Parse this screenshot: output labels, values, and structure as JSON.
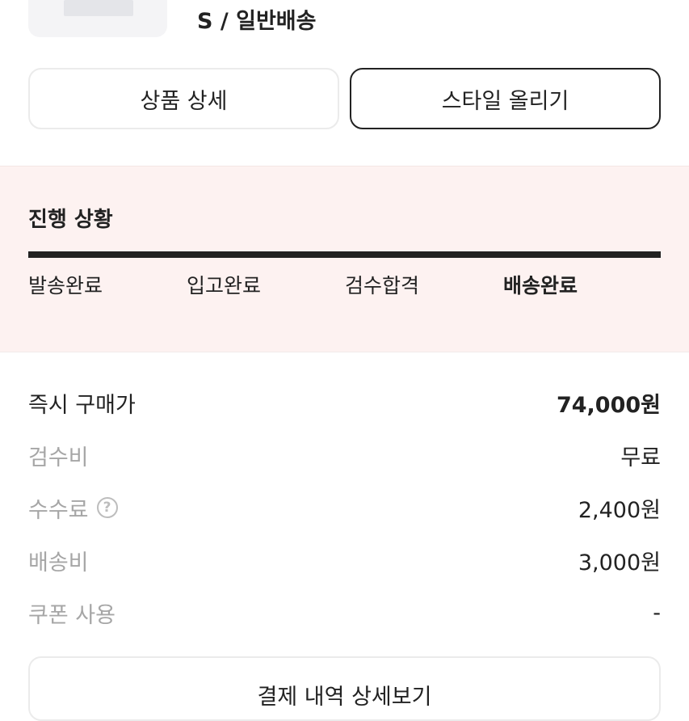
{
  "product": {
    "option_text": "S / 일반배송"
  },
  "buttons": {
    "detail_label": "상품 상세",
    "style_label": "스타일 올리기"
  },
  "progress": {
    "title": "진행 상황",
    "steps": [
      "발송완료",
      "입고완료",
      "검수합격",
      "배송완료"
    ],
    "current_step": "배송완료"
  },
  "price": {
    "rows": [
      {
        "label": "즉시 구매가",
        "value": "74,000원"
      },
      {
        "label": "검수비",
        "value": "무료"
      },
      {
        "label": "수수료",
        "value": "2,400원",
        "icon": "help-circle-icon"
      },
      {
        "label": "배송비",
        "value": "3,000원"
      },
      {
        "label": "쿠폰 사용",
        "value": "-"
      }
    ]
  },
  "payment_button": {
    "label": "결제 내역 상세보기"
  }
}
